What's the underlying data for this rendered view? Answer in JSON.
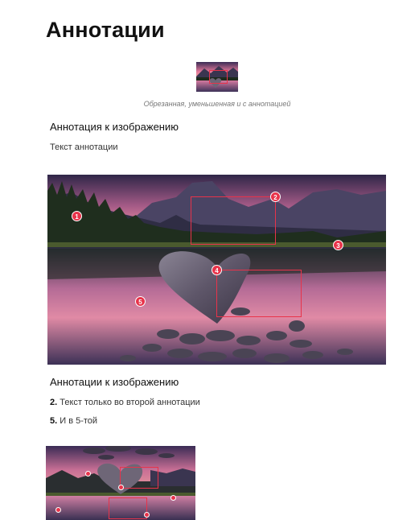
{
  "page": {
    "title": "Аннотации"
  },
  "thumbnail": {
    "caption": "Обрезанная, уменьшенная и с аннотацией"
  },
  "section1": {
    "heading": "Аннотация к изображению",
    "text": "Текст аннотации"
  },
  "main_image": {
    "markers": [
      {
        "label": "1"
      },
      {
        "label": "2"
      },
      {
        "label": "3"
      },
      {
        "label": "4"
      },
      {
        "label": "5"
      }
    ]
  },
  "section2": {
    "heading": "Аннотации к изображению",
    "notes": [
      {
        "number": "2.",
        "text": "Текст только во второй аннотации"
      },
      {
        "number": "5.",
        "text": "И в 5-той"
      }
    ]
  },
  "colors": {
    "accent": "#e8334a",
    "sky_top": "#3a2c55",
    "sky_glow": "#e3789a",
    "mountain": "#3a3550",
    "forest": "#1d2a1c",
    "water": "#4c3d68",
    "stone": "#6e6677"
  }
}
